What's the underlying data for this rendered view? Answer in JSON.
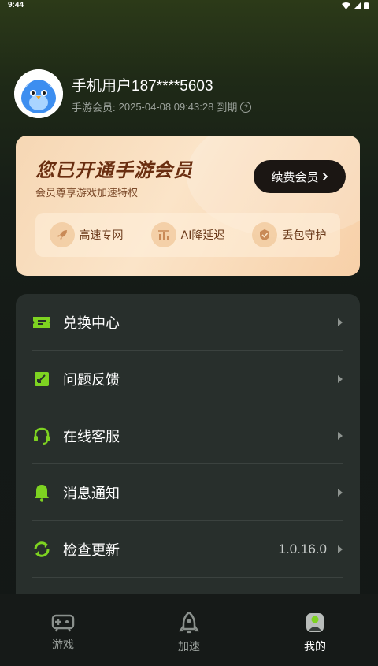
{
  "status": {
    "time": "9:44"
  },
  "profile": {
    "username": "手机用户187****5603",
    "member_prefix": "手游会员: ",
    "expire_datetime": "2025-04-08 09:43:28",
    "expire_suffix": " 到期",
    "help_glyph": "?"
  },
  "vip": {
    "title": "您已开通手游会员",
    "subtitle": "会员尊享游戏加速特权",
    "renew_label": "续费会员",
    "perks": [
      {
        "label": "高速专网",
        "icon": "rocket-icon"
      },
      {
        "label": "AI降延迟",
        "icon": "latency-icon"
      },
      {
        "label": "丢包守护",
        "icon": "shield-icon"
      }
    ]
  },
  "menu": [
    {
      "label": "兑换中心",
      "icon": "ticket-icon",
      "value": ""
    },
    {
      "label": "问题反馈",
      "icon": "feedback-icon",
      "value": ""
    },
    {
      "label": "在线客服",
      "icon": "headset-icon",
      "value": ""
    },
    {
      "label": "消息通知",
      "icon": "bell-icon",
      "value": ""
    },
    {
      "label": "检查更新",
      "icon": "refresh-icon",
      "value": "1.0.16.0"
    }
  ],
  "tabs": [
    {
      "label": "游戏",
      "icon": "gamepad-icon",
      "active": false
    },
    {
      "label": "加速",
      "icon": "rocket-tab-icon",
      "active": false
    },
    {
      "label": "我的",
      "icon": "user-icon",
      "active": true
    }
  ],
  "colors": {
    "accent_green": "#7ed321",
    "vip_text": "#6a2e10",
    "menu_bg": "#282f2c"
  }
}
